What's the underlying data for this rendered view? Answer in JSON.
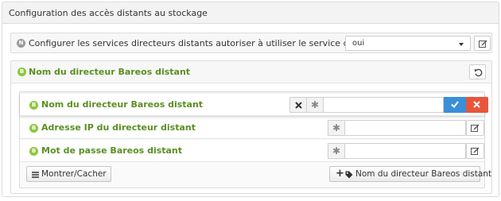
{
  "panel": {
    "title": "Configuration des accès distants au stockage"
  },
  "config_row": {
    "badge": "N",
    "label": "Configurer les services directeurs distants autoriser à utiliser le service de stockage local",
    "select_value": "oui"
  },
  "group": {
    "badge": "B",
    "title": "Nom du directeur Bareos distant"
  },
  "fields": [
    {
      "badge": "B",
      "label": "Nom du directeur Bareos distant",
      "value": "",
      "marker": "✱"
    },
    {
      "badge": "B",
      "label": "Adresse IP du directeur distant",
      "value": "",
      "marker": "✱"
    },
    {
      "badge": "B",
      "label": "Mot de passe Bareos distant",
      "value": "",
      "marker": "✱"
    }
  ],
  "actions": {
    "toggle_label": "Montrer/Cacher",
    "add_label": "Nom du directeur Bareos distant",
    "add_prefix": "+"
  },
  "colors": {
    "badge_green": "#8cc63f",
    "badge_gray": "#9a9a9a",
    "label_green": "#5b8f22",
    "confirm_blue": "#3a8fd9",
    "cancel_red": "#e9553b"
  },
  "icons": [
    "caret-down-icon",
    "edit-icon",
    "undo-icon",
    "times-icon",
    "asterisk-icon",
    "check-icon",
    "bars-icon",
    "plus-icon",
    "tag-icon"
  ]
}
